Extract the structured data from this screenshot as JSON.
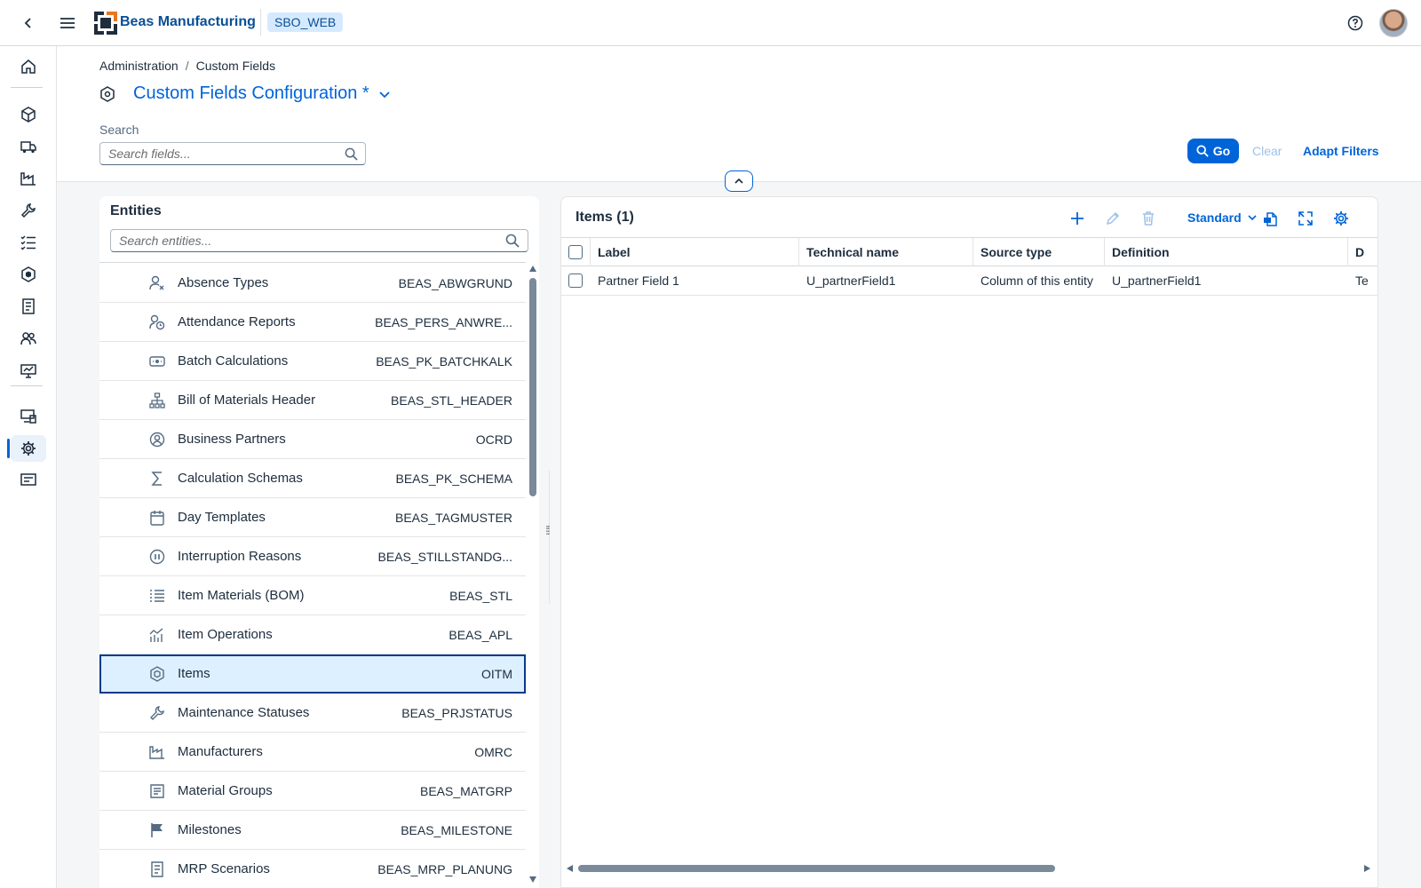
{
  "shell": {
    "app_title": "Beas Manufacturing",
    "system": "SBO_WEB",
    "icons": {
      "back": "chevron-left-icon",
      "menu": "hamburger-icon",
      "help": "help-icon"
    }
  },
  "sidenav": {
    "items": [
      {
        "name": "home",
        "icon": "home-icon"
      },
      {
        "name": "products",
        "icon": "cubes-icon"
      },
      {
        "name": "logistics",
        "icon": "truck-icon"
      },
      {
        "name": "factory",
        "icon": "factory-icon"
      },
      {
        "name": "tools",
        "icon": "wrench-icon"
      },
      {
        "name": "tasks",
        "icon": "checklist-icon"
      },
      {
        "name": "items",
        "icon": "hexagon-box-icon"
      },
      {
        "name": "documents",
        "icon": "document-icon"
      },
      {
        "name": "people",
        "icon": "group-icon"
      },
      {
        "name": "reports",
        "icon": "monitor-chart-icon"
      },
      {
        "name": "devices",
        "icon": "devices-icon"
      },
      {
        "name": "settings",
        "icon": "gear-icon",
        "active": true
      },
      {
        "name": "forms",
        "icon": "form-icon"
      }
    ]
  },
  "header": {
    "breadcrumb": [
      "Administration",
      "Custom Fields"
    ],
    "title": "Custom Fields Configuration *",
    "search_label": "Search",
    "search_placeholder": "Search fields...",
    "go_label": "Go",
    "clear_label": "Clear",
    "adapt_label": "Adapt Filters"
  },
  "entities": {
    "title": "Entities",
    "search_placeholder": "Search entities...",
    "selected": "Items",
    "items": [
      {
        "name": "Absence Types",
        "code": "BEAS_ABWGRUND",
        "icon": "person-x-icon"
      },
      {
        "name": "Attendance Reports",
        "code": "BEAS_PERS_ANWRE...",
        "icon": "person-clock-icon"
      },
      {
        "name": "Batch Calculations",
        "code": "BEAS_PK_BATCHKALK",
        "icon": "batch-icon"
      },
      {
        "name": "Bill of Materials Header",
        "code": "BEAS_STL_HEADER",
        "icon": "hierarchy-icon"
      },
      {
        "name": "Business Partners",
        "code": "OCRD",
        "icon": "person-circle-icon"
      },
      {
        "name": "Calculation Schemas",
        "code": "BEAS_PK_SCHEMA",
        "icon": "sigma-icon"
      },
      {
        "name": "Day Templates",
        "code": "BEAS_TAGMUSTER",
        "icon": "calendar-icon"
      },
      {
        "name": "Interruption Reasons",
        "code": "BEAS_STILLSTANDG...",
        "icon": "pause-circle-icon"
      },
      {
        "name": "Item Materials (BOM)",
        "code": "BEAS_STL",
        "icon": "list-icon"
      },
      {
        "name": "Item Operations",
        "code": "BEAS_APL",
        "icon": "line-chart-icon"
      },
      {
        "name": "Items",
        "code": "OITM",
        "icon": "hexagon-box-icon"
      },
      {
        "name": "Maintenance Statuses",
        "code": "BEAS_PRJSTATUS",
        "icon": "wrench-icon"
      },
      {
        "name": "Manufacturers",
        "code": "OMRC",
        "icon": "factory-icon"
      },
      {
        "name": "Material Groups",
        "code": "BEAS_MATGRP",
        "icon": "form-icon"
      },
      {
        "name": "Milestones",
        "code": "BEAS_MILESTONE",
        "icon": "flag-icon"
      },
      {
        "name": "MRP Scenarios",
        "code": "BEAS_MRP_PLANUNG",
        "icon": "document-icon"
      }
    ]
  },
  "items_table": {
    "title": "Items (1)",
    "variant": "Standard",
    "columns": [
      "Label",
      "Technical name",
      "Source type",
      "Definition",
      "D"
    ],
    "rows": [
      {
        "label": "Partner Field 1",
        "technical": "U_partnerField1",
        "source": "Column of this entity",
        "definition": "U_partnerField1",
        "extra": "Te"
      }
    ],
    "toolbar_icons": [
      "add-icon",
      "edit-icon",
      "delete-icon",
      "export-icon",
      "fullscreen-icon",
      "settings-icon"
    ]
  },
  "colors": {
    "accent": "#0064d9",
    "brand_text": "#0a4f96",
    "selected_row": "#dcf0ff"
  }
}
